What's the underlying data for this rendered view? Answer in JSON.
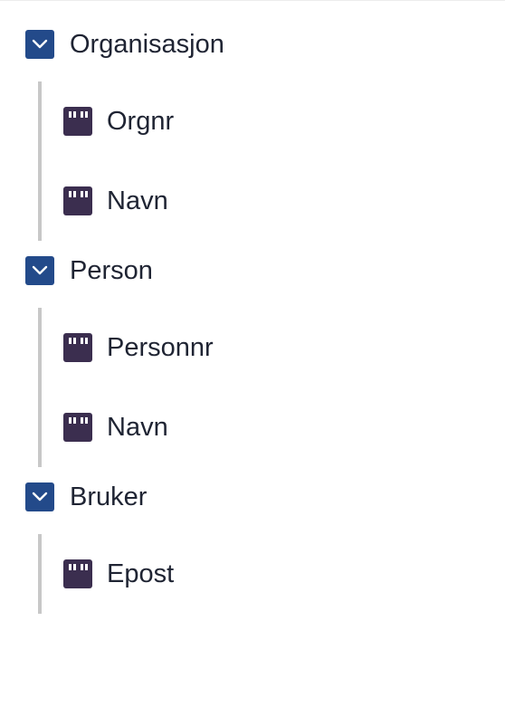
{
  "colors": {
    "toggle_bg": "#234a8a",
    "field_icon": "#3b2e4f",
    "connector": "#c8c8c8",
    "text": "#1f2433"
  },
  "icons": {
    "toggle": "chevron-down-icon",
    "field": "text-field-icon"
  },
  "tree": [
    {
      "label": "Organisasjon",
      "expanded": true,
      "children": [
        {
          "label": "Orgnr"
        },
        {
          "label": "Navn"
        }
      ]
    },
    {
      "label": "Person",
      "expanded": true,
      "children": [
        {
          "label": "Personnr"
        },
        {
          "label": "Navn"
        }
      ]
    },
    {
      "label": "Bruker",
      "expanded": true,
      "children": [
        {
          "label": "Epost"
        }
      ]
    }
  ]
}
